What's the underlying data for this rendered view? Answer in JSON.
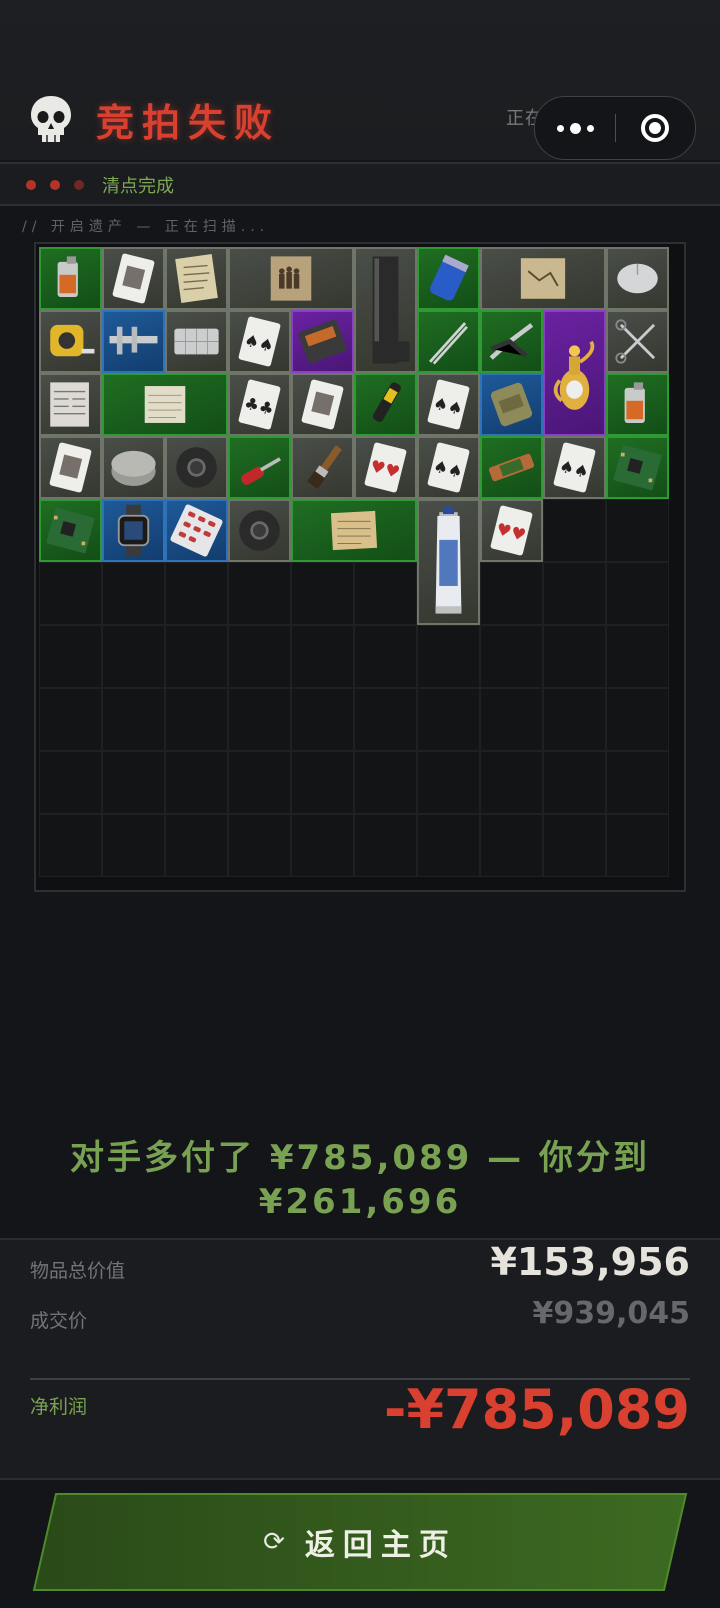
{
  "header": {
    "title": "竞拍失败",
    "restore_text": "正在还原遗产情报...",
    "skull_icon": "skull-icon",
    "more_icon": "more-dots-icon",
    "close_icon": "miniprogram-close-icon"
  },
  "status": {
    "label": "清点完成",
    "dot_color": "#b53428"
  },
  "scan": {
    "text": "// 开启遗产 — 正在扫描..."
  },
  "inventory": {
    "columns": 10,
    "rows": 10,
    "items": [
      {
        "name": "lighter",
        "rarity": "green",
        "col": 0,
        "row": 0,
        "w": 1,
        "h": 1
      },
      {
        "name": "playing-card-portrait",
        "rarity": "gray",
        "col": 1,
        "row": 0,
        "w": 1,
        "h": 1
      },
      {
        "name": "old-letter",
        "rarity": "gray",
        "col": 2,
        "row": 0,
        "w": 1,
        "h": 1
      },
      {
        "name": "old-photograph",
        "rarity": "gray",
        "col": 3,
        "row": 0,
        "w": 2,
        "h": 1
      },
      {
        "name": "black-bar",
        "rarity": "gray",
        "col": 5,
        "row": 0,
        "w": 1,
        "h": 2
      },
      {
        "name": "capacitor",
        "rarity": "green",
        "col": 6,
        "row": 0,
        "w": 1,
        "h": 1
      },
      {
        "name": "treasure-map",
        "rarity": "gray",
        "col": 7,
        "row": 0,
        "w": 2,
        "h": 1
      },
      {
        "name": "computer-mouse",
        "rarity": "gray",
        "col": 9,
        "row": 0,
        "w": 1,
        "h": 1
      },
      {
        "name": "tape-measure",
        "rarity": "gray",
        "col": 0,
        "row": 1,
        "w": 1,
        "h": 1
      },
      {
        "name": "vernier-caliper",
        "rarity": "blue",
        "col": 1,
        "row": 1,
        "w": 1,
        "h": 1
      },
      {
        "name": "pill-organizer",
        "rarity": "gray",
        "col": 2,
        "row": 1,
        "w": 1,
        "h": 1
      },
      {
        "name": "playing-card-spades",
        "rarity": "gray",
        "col": 3,
        "row": 1,
        "w": 1,
        "h": 1
      },
      {
        "name": "cassette-tape",
        "rarity": "purple",
        "col": 4,
        "row": 1,
        "w": 1,
        "h": 1
      },
      {
        "name": "tweezers",
        "rarity": "green",
        "col": 6,
        "row": 1,
        "w": 1,
        "h": 1
      },
      {
        "name": "pliers",
        "rarity": "green",
        "col": 7,
        "row": 1,
        "w": 1,
        "h": 1
      },
      {
        "name": "golden-teapot",
        "rarity": "purple",
        "col": 8,
        "row": 1,
        "w": 1,
        "h": 2
      },
      {
        "name": "scissors",
        "rarity": "gray",
        "col": 9,
        "row": 1,
        "w": 1,
        "h": 1
      },
      {
        "name": "newspaper",
        "rarity": "gray",
        "col": 0,
        "row": 2,
        "w": 1,
        "h": 1
      },
      {
        "name": "old-scroll",
        "rarity": "green",
        "col": 1,
        "row": 2,
        "w": 2,
        "h": 1
      },
      {
        "name": "playing-card-clubs",
        "rarity": "gray",
        "col": 3,
        "row": 2,
        "w": 1,
        "h": 1
      },
      {
        "name": "playing-card-portrait",
        "rarity": "gray",
        "col": 4,
        "row": 2,
        "w": 1,
        "h": 1
      },
      {
        "name": "multimeter-pen",
        "rarity": "green",
        "col": 5,
        "row": 2,
        "w": 1,
        "h": 1
      },
      {
        "name": "playing-card-spades",
        "rarity": "gray",
        "col": 6,
        "row": 2,
        "w": 1,
        "h": 1
      },
      {
        "name": "ration-pack",
        "rarity": "blue",
        "col": 7,
        "row": 2,
        "w": 1,
        "h": 1
      },
      {
        "name": "lighter",
        "rarity": "green",
        "col": 9,
        "row": 2,
        "w": 1,
        "h": 1
      },
      {
        "name": "playing-card-portrait",
        "rarity": "gray",
        "col": 0,
        "row": 3,
        "w": 1,
        "h": 1
      },
      {
        "name": "bandage-roll",
        "rarity": "gray",
        "col": 1,
        "row": 3,
        "w": 1,
        "h": 1
      },
      {
        "name": "duct-tape",
        "rarity": "gray",
        "col": 2,
        "row": 3,
        "w": 1,
        "h": 1
      },
      {
        "name": "screwdriver",
        "rarity": "green",
        "col": 3,
        "row": 3,
        "w": 1,
        "h": 1
      },
      {
        "name": "paint-brush",
        "rarity": "gray",
        "col": 4,
        "row": 3,
        "w": 1,
        "h": 1
      },
      {
        "name": "playing-card-hearts",
        "rarity": "gray",
        "col": 5,
        "row": 3,
        "w": 1,
        "h": 1
      },
      {
        "name": "playing-card-spades",
        "rarity": "gray",
        "col": 6,
        "row": 3,
        "w": 1,
        "h": 1
      },
      {
        "name": "energy-bar",
        "rarity": "green",
        "col": 7,
        "row": 3,
        "w": 1,
        "h": 1
      },
      {
        "name": "playing-card-spades",
        "rarity": "gray",
        "col": 8,
        "row": 3,
        "w": 1,
        "h": 1
      },
      {
        "name": "circuit-board",
        "rarity": "green",
        "col": 9,
        "row": 3,
        "w": 1,
        "h": 1
      },
      {
        "name": "circuit-board",
        "rarity": "green",
        "col": 0,
        "row": 4,
        "w": 1,
        "h": 1
      },
      {
        "name": "smart-watch",
        "rarity": "blue",
        "col": 1,
        "row": 4,
        "w": 1,
        "h": 1
      },
      {
        "name": "pill-blister",
        "rarity": "blue",
        "col": 2,
        "row": 4,
        "w": 1,
        "h": 1
      },
      {
        "name": "duct-tape",
        "rarity": "gray",
        "col": 3,
        "row": 4,
        "w": 1,
        "h": 1
      },
      {
        "name": "old-documents",
        "rarity": "green",
        "col": 4,
        "row": 4,
        "w": 2,
        "h": 1
      },
      {
        "name": "toothpaste",
        "rarity": "gray",
        "col": 6,
        "row": 4,
        "w": 1,
        "h": 2
      },
      {
        "name": "playing-card-hearts",
        "rarity": "gray",
        "col": 7,
        "row": 4,
        "w": 1,
        "h": 1
      }
    ]
  },
  "result": {
    "message": "对手多付了 ¥785,089 — 你分到 ¥261,696"
  },
  "summary": {
    "total_label": "物品总价值",
    "total_value": "¥153,956",
    "deal_label": "成交价",
    "deal_value": "¥939,045",
    "profit_label": "净利润",
    "profit_value": "-¥785,089",
    "profit_color": "#d94030"
  },
  "actions": {
    "home_label": "返回主页",
    "home_icon": "refresh-icon"
  }
}
